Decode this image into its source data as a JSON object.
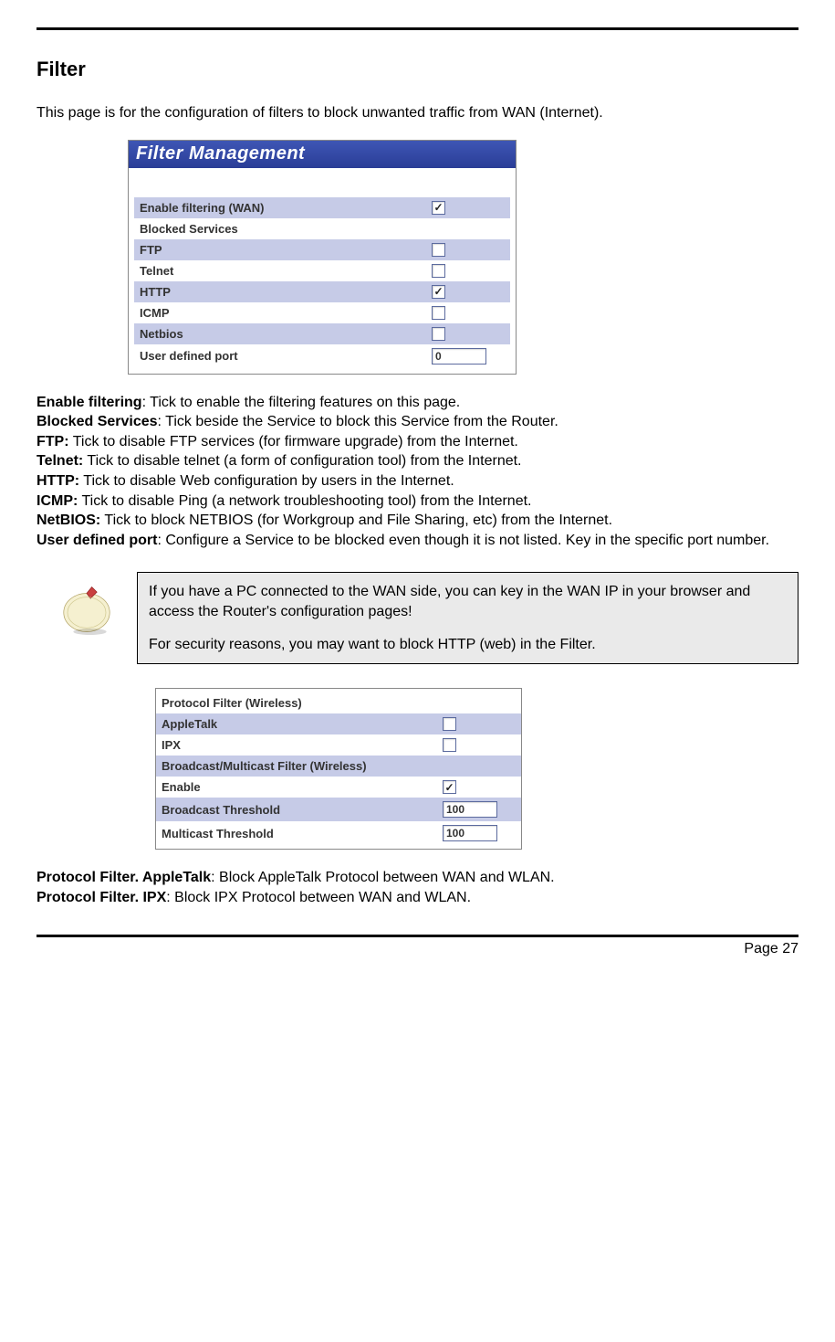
{
  "title": "Filter",
  "intro": "This page is for the configuration of filters to block unwanted traffic from WAN (Internet).",
  "shot1": {
    "header": "Filter Management",
    "rows": [
      {
        "label": "Enable filtering (WAN)",
        "type": "chk",
        "checked": true,
        "alt": true
      },
      {
        "label": "Blocked Services",
        "type": "header",
        "alt": false
      },
      {
        "label": "FTP",
        "type": "chk",
        "checked": false,
        "alt": true
      },
      {
        "label": "Telnet",
        "type": "chk",
        "checked": false,
        "alt": false
      },
      {
        "label": "HTTP",
        "type": "chk",
        "checked": true,
        "alt": true
      },
      {
        "label": "ICMP",
        "type": "chk",
        "checked": false,
        "alt": false
      },
      {
        "label": "Netbios",
        "type": "chk",
        "checked": false,
        "alt": true
      },
      {
        "label": "User defined port",
        "type": "txt",
        "value": "0",
        "alt": false
      }
    ]
  },
  "defs1": [
    {
      "term": "Enable filtering",
      "text": ": Tick to enable the filtering features on this page."
    },
    {
      "term": "Blocked Services",
      "text": ": Tick beside the Service to block this Service from the Router."
    },
    {
      "term": "FTP:",
      "text": " Tick to disable FTP services (for firmware upgrade) from the Internet."
    },
    {
      "term": "Telnet:",
      "text": " Tick to disable telnet (a form of configuration tool) from the Internet."
    },
    {
      "term": "HTTP:",
      "text": " Tick to disable Web configuration by users in the Internet."
    },
    {
      "term": "ICMP:",
      "text": " Tick to disable Ping (a network troubleshooting tool) from the Internet."
    },
    {
      "term": "NetBIOS:",
      "text": " Tick to block NETBIOS (for Workgroup and File Sharing, etc) from the Internet."
    },
    {
      "term": "User defined port",
      "text": ": Configure a Service to be blocked even though it is not listed. Key in the specific port number.",
      "justify": true
    }
  ],
  "note": {
    "p1": "If you have a PC connected to the WAN side, you can key in the WAN IP in your browser and access the Router's configuration pages!",
    "p2": "For security reasons, you may want to block HTTP (web) in the Filter."
  },
  "shot2": {
    "rows": [
      {
        "label": "Protocol Filter (Wireless)",
        "type": "header",
        "alt": false
      },
      {
        "label": "AppleTalk",
        "type": "chk",
        "checked": false,
        "alt": true
      },
      {
        "label": "IPX",
        "type": "chk",
        "checked": false,
        "alt": false
      },
      {
        "label": "Broadcast/Multicast Filter (Wireless)",
        "type": "header",
        "alt": true
      },
      {
        "label": "Enable",
        "type": "chk",
        "checked": true,
        "alt": false
      },
      {
        "label": "Broadcast Threshold",
        "type": "txt",
        "value": "100",
        "alt": true
      },
      {
        "label": "Multicast Threshold",
        "type": "txt",
        "value": "100",
        "alt": false
      }
    ]
  },
  "defs2": [
    {
      "term": "Protocol Filter. AppleTalk",
      "text": ": Block AppleTalk Protocol between WAN and WLAN."
    },
    {
      "term": "Protocol Filter. IPX",
      "text": ": Block IPX Protocol between WAN and WLAN."
    }
  ],
  "footer": "Page 27"
}
